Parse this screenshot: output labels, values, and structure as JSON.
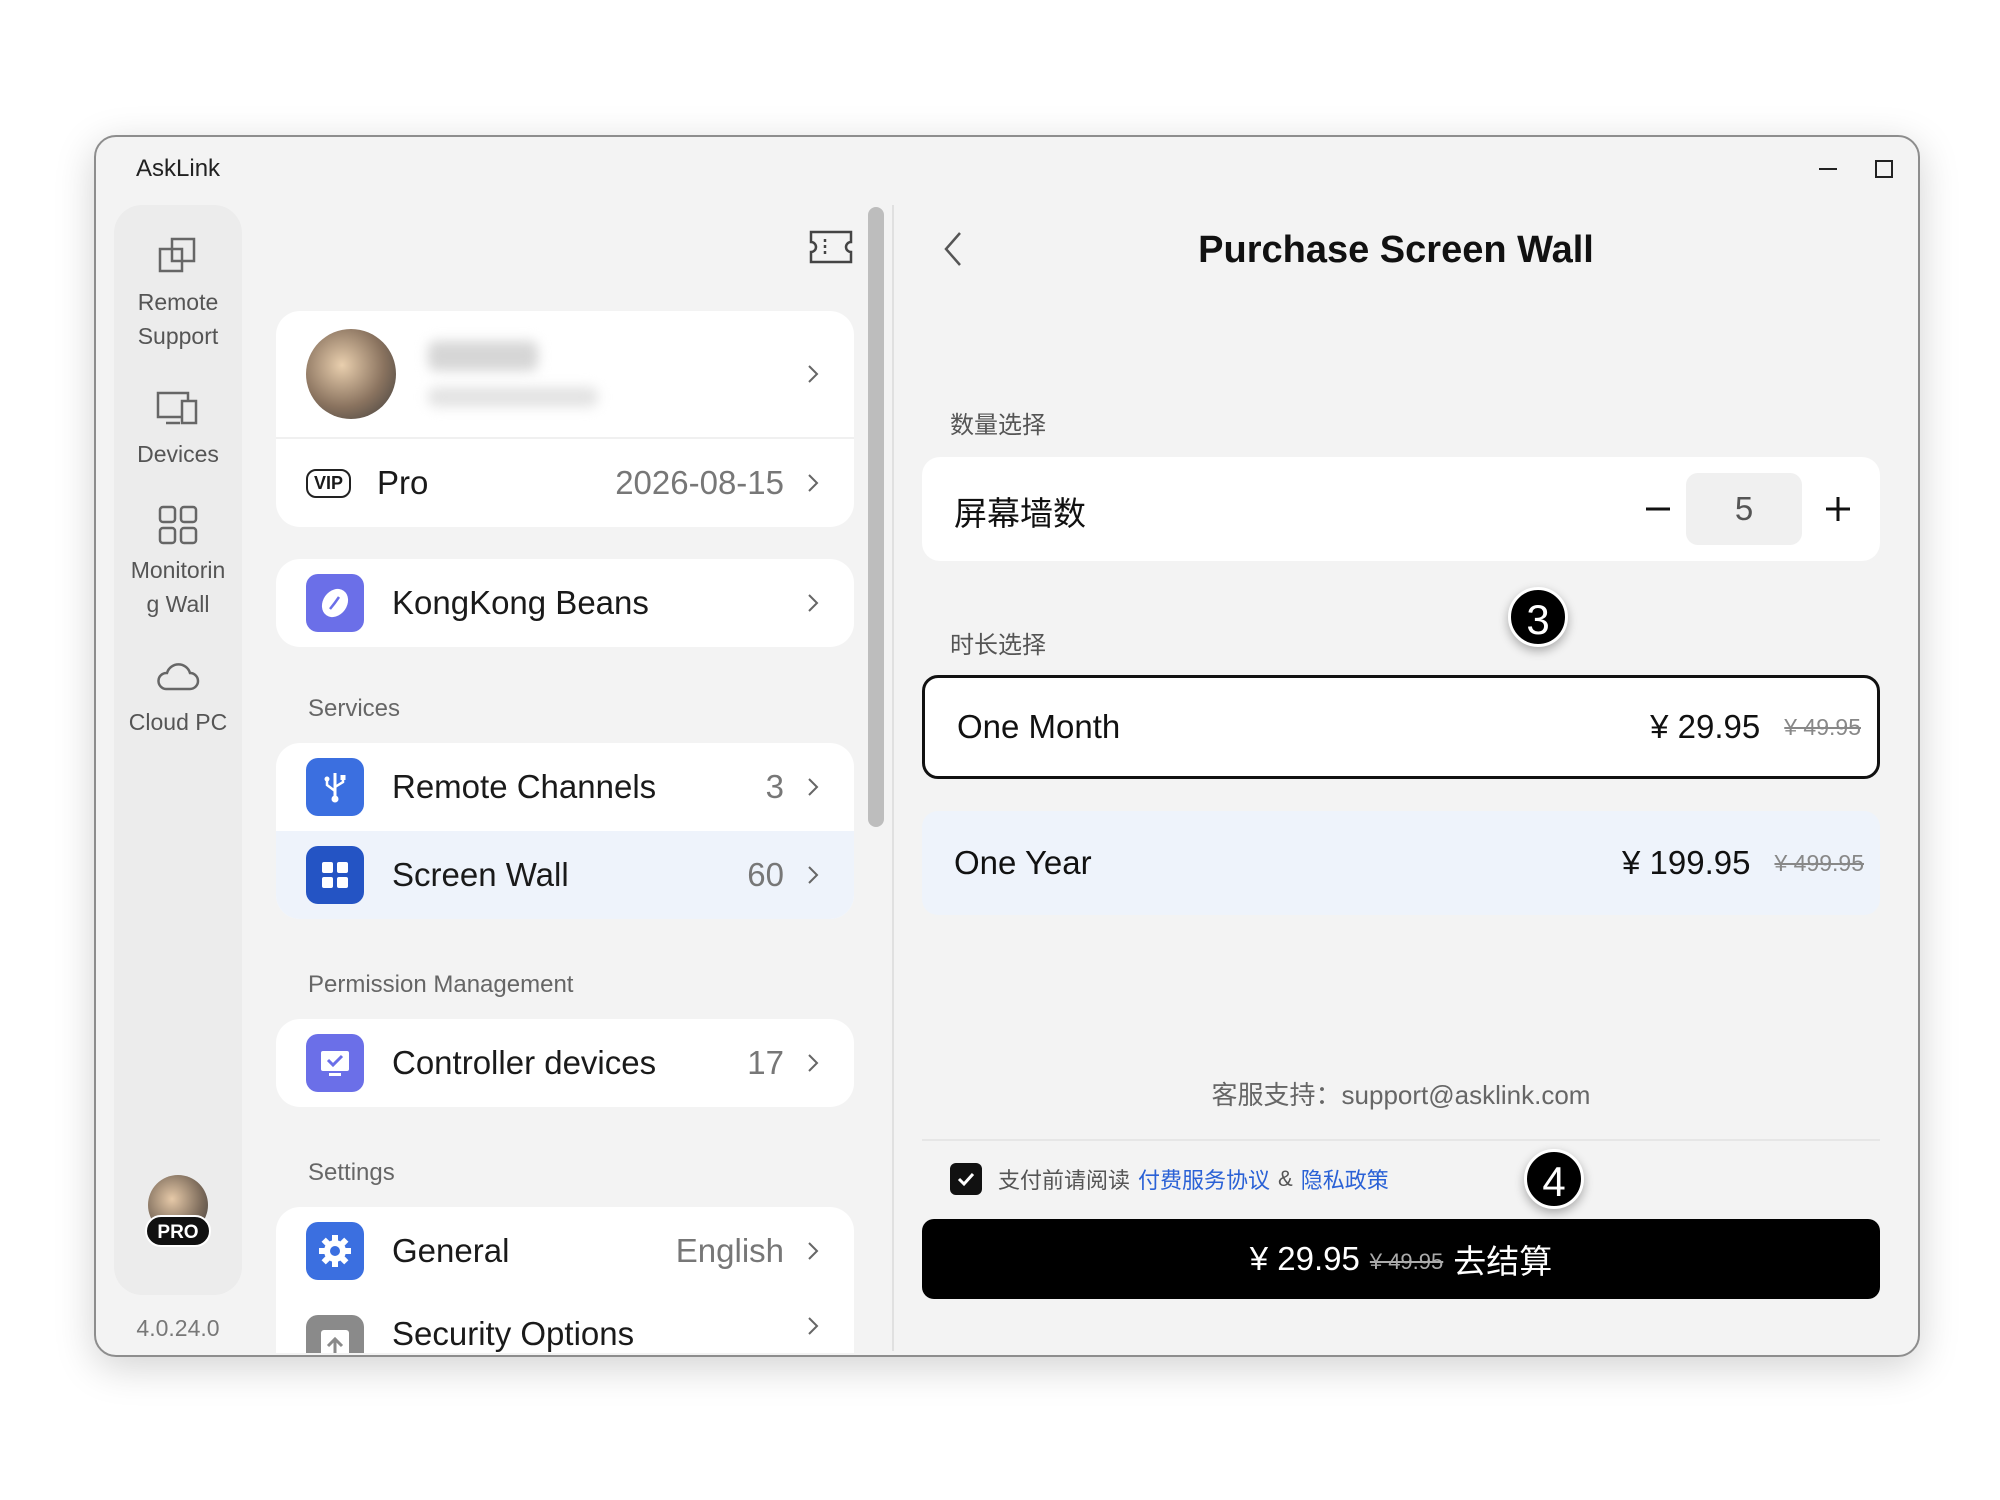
{
  "window": {
    "title": "AskLink"
  },
  "nav": {
    "items": [
      {
        "label": "Remote Support",
        "icon": "remote-support-icon"
      },
      {
        "label": "Devices",
        "icon": "devices-icon"
      },
      {
        "label": "Monitoring Wall",
        "icon": "monitoring-wall-icon"
      },
      {
        "label": "Cloud PC",
        "icon": "cloud-icon"
      }
    ],
    "pro_badge": "PRO",
    "version": "4.0.24.0"
  },
  "account": {
    "membership_tag": "VIP",
    "membership_label": "Pro",
    "membership_expiry": "2026-08-15"
  },
  "beans": {
    "label": "KongKong Beans"
  },
  "services": {
    "section_label": "Services",
    "items": [
      {
        "label": "Remote Channels",
        "value": "3"
      },
      {
        "label": "Screen Wall",
        "value": "60"
      }
    ]
  },
  "permissions": {
    "section_label": "Permission Management",
    "items": [
      {
        "label": "Controller devices",
        "value": "17"
      }
    ]
  },
  "settings": {
    "section_label": "Settings",
    "items": [
      {
        "label": "General",
        "value": "English"
      },
      {
        "label": "Security Options",
        "value": ""
      }
    ]
  },
  "purchase": {
    "title": "Purchase Screen Wall",
    "quantity_section": "数量选择",
    "quantity_label": "屏幕墙数",
    "quantity_value": "5",
    "duration_section": "时长选择",
    "plans": [
      {
        "name": "One Month",
        "price": "¥ 29.95",
        "original": "¥ 49.95",
        "selected": true
      },
      {
        "name": "One Year",
        "price": "¥ 199.95",
        "original": "¥ 499.95",
        "selected": false
      }
    ],
    "support_text": "客服支持：support@asklink.com",
    "agree_prefix": "支付前请阅读",
    "agree_link1": "付费服务协议",
    "agree_and": "&",
    "agree_link2": "隐私政策",
    "agree_checked": true,
    "pay_price": "¥ 29.95",
    "pay_original": "¥ 49.95",
    "pay_label": "去结算"
  },
  "annotations": {
    "step3": "3",
    "step4": "4"
  },
  "colors": {
    "accent_blue": "#3b6fe0",
    "link_blue": "#2a61d6",
    "active_row": "#eef3fb",
    "beans_purple": "#6b6fe8"
  }
}
